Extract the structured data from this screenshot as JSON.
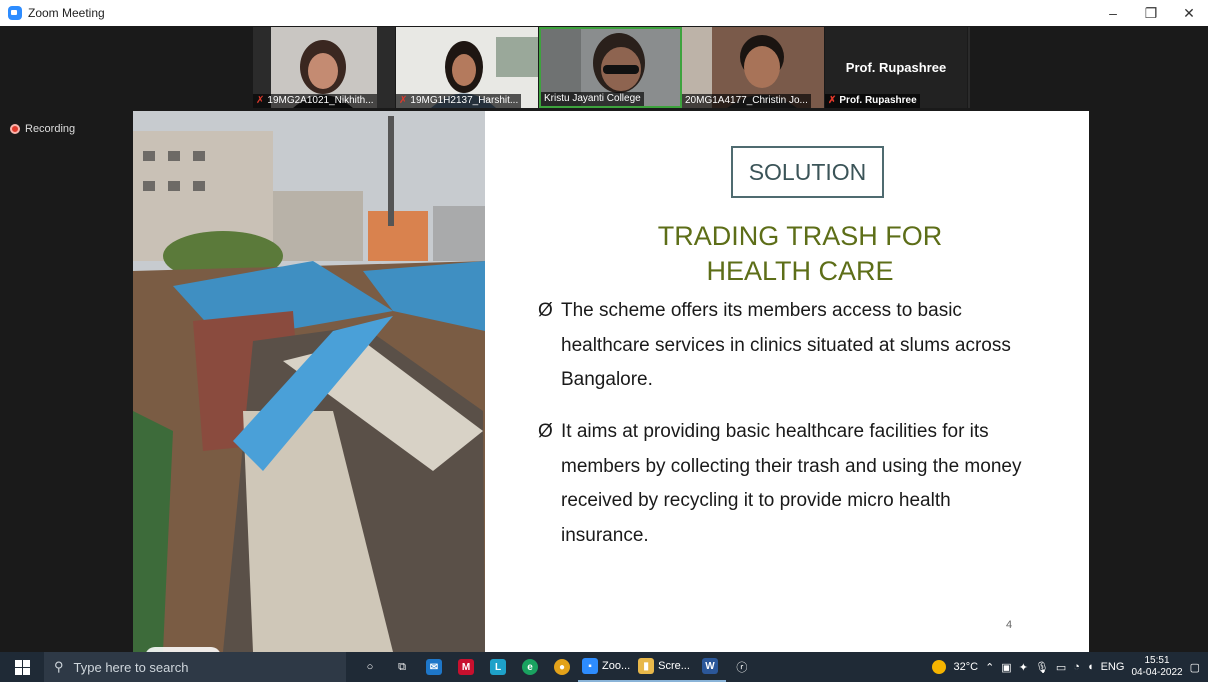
{
  "window": {
    "title": "Zoom Meeting"
  },
  "participants": [
    {
      "name": "19MG2A1021_Nikhith...",
      "muted": true
    },
    {
      "name": "19MG1H2137_Harshit...",
      "muted": true
    },
    {
      "name": "Kristu Jayanti College",
      "muted": false,
      "active": true
    },
    {
      "name": "20MG1A4177_Christin Jo...",
      "muted": false
    },
    {
      "name": "Prof. Rupashree",
      "muted": true,
      "video": false,
      "card": "Prof. Rupashree"
    }
  ],
  "recording": {
    "label": "Recording"
  },
  "slide": {
    "solution_label": "SOLUTION",
    "heading_line1": "TRADING TRASH FOR",
    "heading_line2": "HEALTH CARE",
    "bullet_mark": "Ø",
    "bullets": [
      "The scheme offers its members access to basic healthcare services in clinics situated at slums across Bangalore.",
      "It aims at providing basic healthcare facilities for its members by collecting their trash and using the money received by recycling it to provide micro health insurance."
    ],
    "number": "4"
  },
  "pager": {
    "page": "4"
  },
  "taskbar": {
    "search_placeholder": "Type here to search",
    "apps": [
      {
        "name": "cortana-icon",
        "label": ""
      },
      {
        "name": "task-view-icon",
        "label": ""
      },
      {
        "name": "mail-icon",
        "label": ""
      },
      {
        "name": "mcafee-icon",
        "label": ""
      },
      {
        "name": "lens-app-icon",
        "label": ""
      },
      {
        "name": "edge-icon",
        "label": ""
      },
      {
        "name": "chrome-icon",
        "label": ""
      },
      {
        "name": "zoom-taskbar-icon",
        "label": "Zoo..."
      },
      {
        "name": "screenshot-folder-icon",
        "label": "Scre..."
      },
      {
        "name": "word-icon",
        "label": ""
      },
      {
        "name": "people-icon",
        "label": ""
      }
    ],
    "weather": "32°C",
    "language": "ENG",
    "time": "15:51",
    "date": "04-04-2022"
  }
}
